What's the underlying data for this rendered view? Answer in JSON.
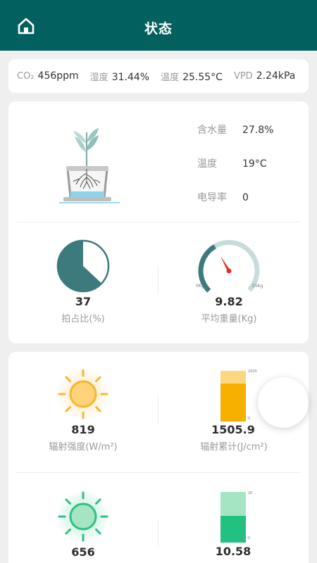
{
  "header": {
    "title": "状态",
    "home_icon": "home-icon"
  },
  "stats": [
    {
      "label": "CO₂",
      "value": "456ppm"
    },
    {
      "label": "湿度",
      "value": "31.44%"
    },
    {
      "label": "温度",
      "value": "25.55°C"
    },
    {
      "label": "VPD",
      "value": "2.24kPa"
    }
  ],
  "soil": [
    {
      "label": "含水量",
      "value": "27.8%"
    },
    {
      "label": "温度",
      "value": "19°C"
    },
    {
      "label": "电导率",
      "value": "0"
    }
  ],
  "pie": {
    "value": "37",
    "label": "拍占比(%)",
    "fraction": 0.63
  },
  "gauge": {
    "value": "9.82",
    "label": "平均重量(Kg)",
    "min_label": "0Kg",
    "max_label": "25Kg",
    "level": 0.39
  },
  "radiation": {
    "value": "819",
    "label": "辐射强度(W/m²)"
  },
  "radiation_total": {
    "value": "1505.9",
    "label": "辐射累计(J/cm²)",
    "max_label": "2000",
    "min_label": "0",
    "level": 0.75
  },
  "par": {
    "value": "656"
  },
  "par_total": {
    "value": "10.58",
    "max_label": "20",
    "min_label": "0",
    "level": 0.53
  },
  "colors": {
    "header": "#02615f",
    "teal": "#3d7a7e",
    "sun": "#f5b731",
    "green_sun": "#2fbf87",
    "bar_orange": "#f8b000",
    "bar_green": "#22c182"
  }
}
